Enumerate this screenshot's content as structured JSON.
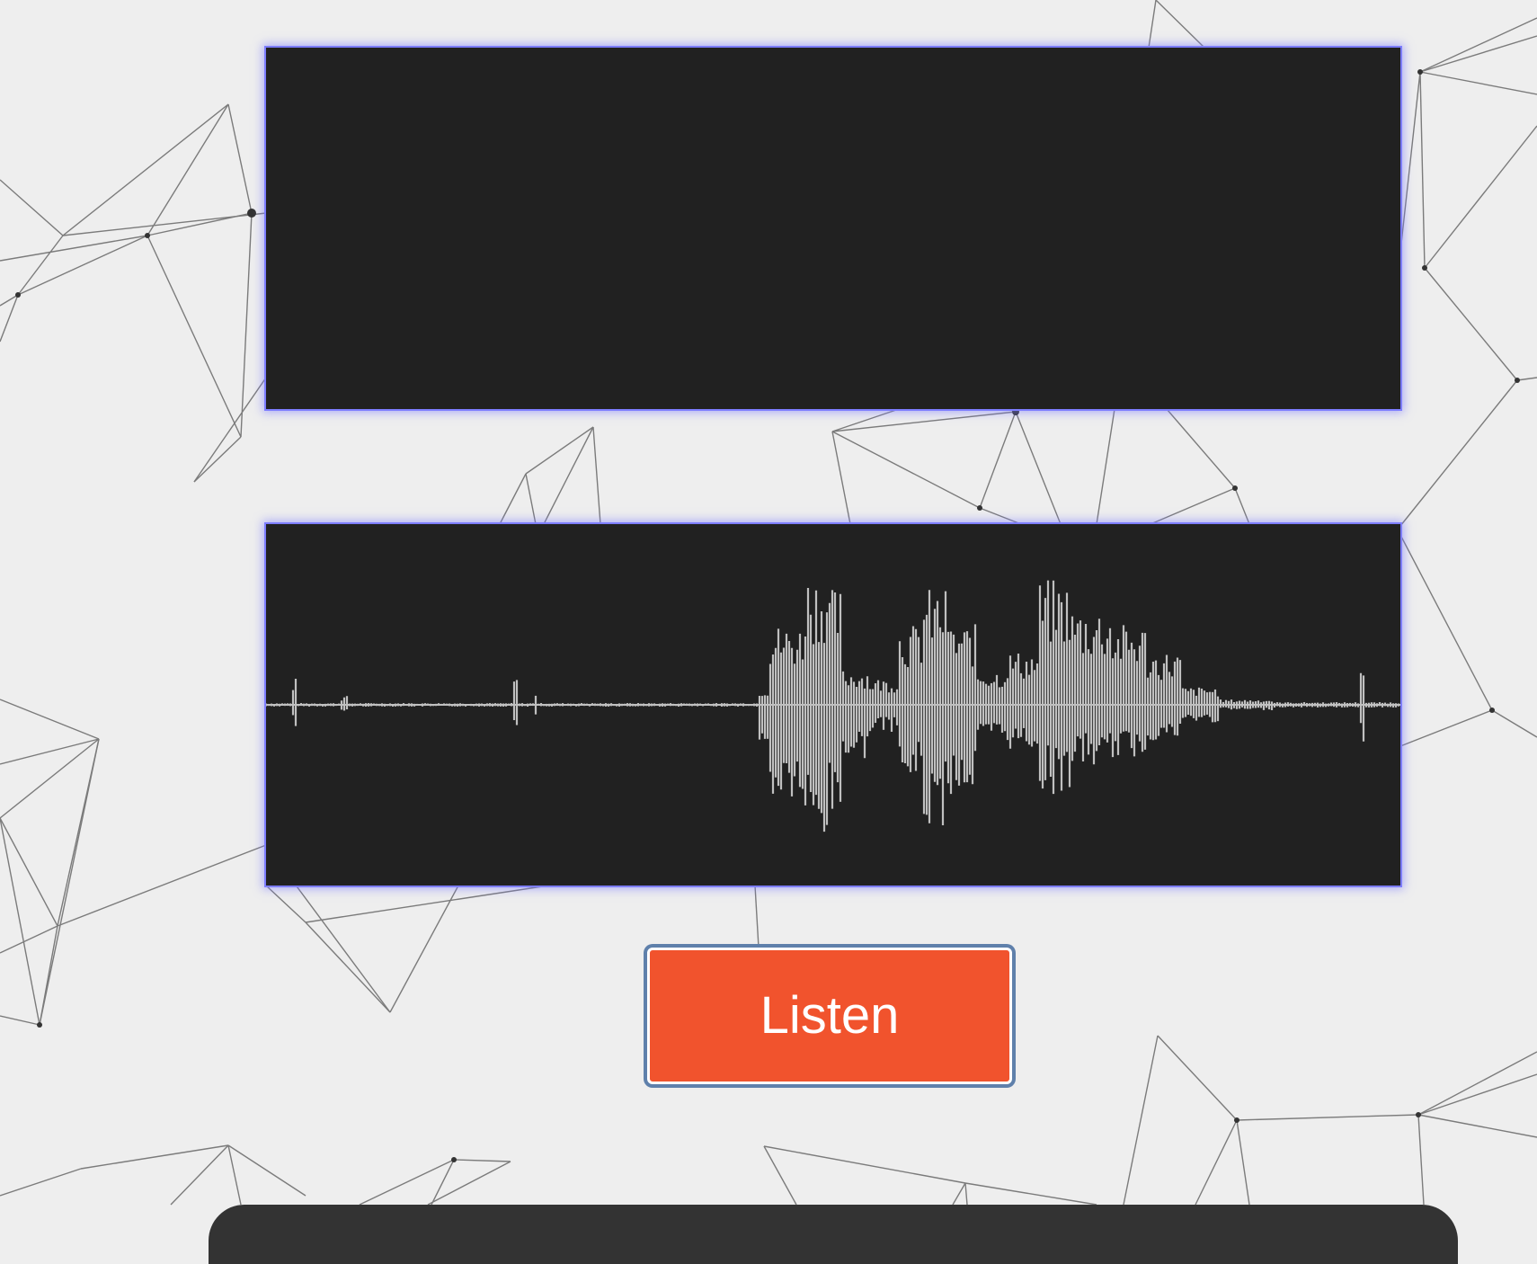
{
  "listen_button": {
    "label": "Listen"
  },
  "colors": {
    "page_background": "#eeeeee",
    "panel_background": "#212121",
    "panel_glow": "#7d7dff",
    "waveform": "#c0c0c0",
    "button_background": "#f1532d",
    "button_text": "#ffffff",
    "button_ring": "#5f80ab",
    "card_background": "#333333",
    "network_lines": "#555555"
  },
  "icons": [
    "waveform-display",
    "network-background"
  ]
}
